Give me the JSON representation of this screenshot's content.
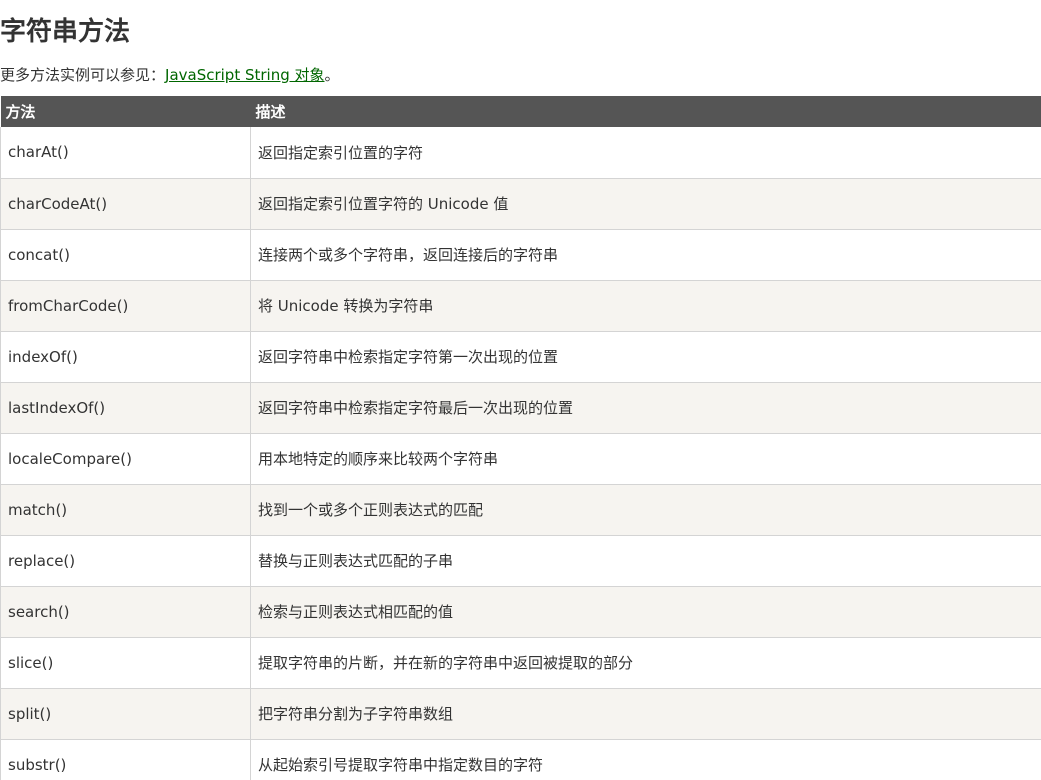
{
  "heading": "字符串方法",
  "intro": {
    "text": "更多方法实例可以参见：",
    "link_text": "JavaScript String 对象",
    "suffix": "。"
  },
  "table": {
    "headers": [
      "方法",
      "描述"
    ],
    "rows": [
      {
        "method": "charAt()",
        "desc": "返回指定索引位置的字符"
      },
      {
        "method": "charCodeAt()",
        "desc": "返回指定索引位置字符的 Unicode 值"
      },
      {
        "method": "concat()",
        "desc": "连接两个或多个字符串，返回连接后的字符串"
      },
      {
        "method": "fromCharCode()",
        "desc": "将 Unicode 转换为字符串"
      },
      {
        "method": "indexOf()",
        "desc": "返回字符串中检索指定字符第一次出现的位置"
      },
      {
        "method": "lastIndexOf()",
        "desc": "返回字符串中检索指定字符最后一次出现的位置"
      },
      {
        "method": "localeCompare()",
        "desc": "用本地特定的顺序来比较两个字符串"
      },
      {
        "method": "match()",
        "desc": "找到一个或多个正则表达式的匹配"
      },
      {
        "method": "replace()",
        "desc": "替换与正则表达式匹配的子串"
      },
      {
        "method": "search()",
        "desc": "检索与正则表达式相匹配的值"
      },
      {
        "method": "slice()",
        "desc": "提取字符串的片断，并在新的字符串中返回被提取的部分"
      },
      {
        "method": "split()",
        "desc": "把字符串分割为子字符串数组"
      },
      {
        "method": "substr()",
        "desc": "从起始索引号提取字符串中指定数目的字符"
      }
    ]
  },
  "colors": {
    "header_bg": "#555555",
    "header_text": "#ffffff",
    "link": "#006600",
    "stripe": "#f6f4f0",
    "border": "#d4d4d4"
  }
}
